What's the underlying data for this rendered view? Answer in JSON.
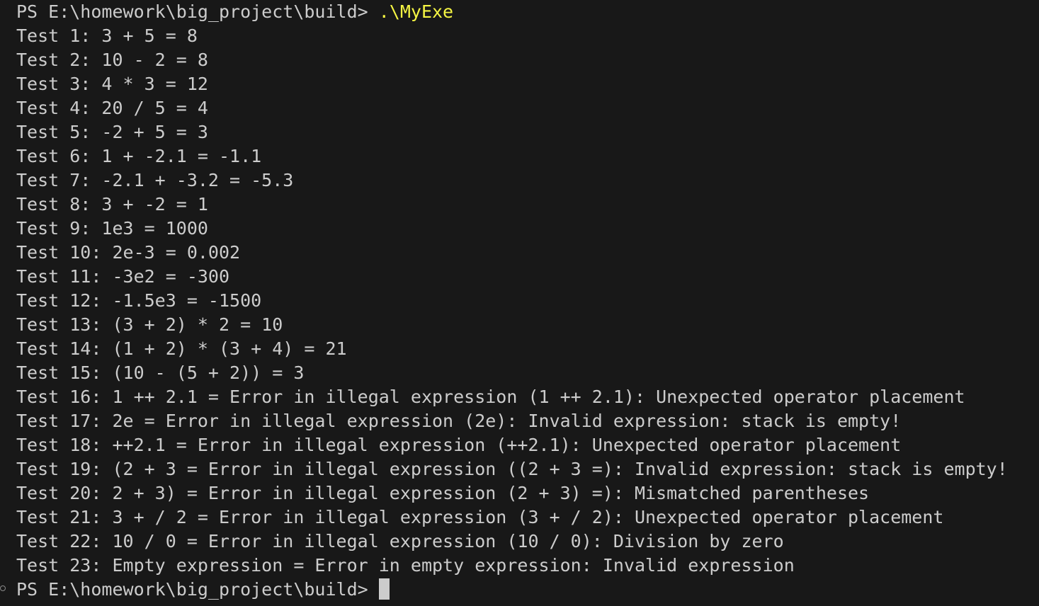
{
  "terminal": {
    "prompt_top": "PS E:\\homework\\big_project\\build> ",
    "command": ".\\MyExe",
    "output_lines": [
      "Test 1: 3 + 5 = 8",
      "Test 2: 10 - 2 = 8",
      "Test 3: 4 * 3 = 12",
      "Test 4: 20 / 5 = 4",
      "Test 5: -2 + 5 = 3",
      "Test 6: 1 + -2.1 = -1.1",
      "Test 7: -2.1 + -3.2 = -5.3",
      "Test 8: 3 + -2 = 1",
      "Test 9: 1e3 = 1000",
      "Test 10: 2e-3 = 0.002",
      "Test 11: -3e2 = -300",
      "Test 12: -1.5e3 = -1500",
      "Test 13: (3 + 2) * 2 = 10",
      "Test 14: (1 + 2) * (3 + 4) = 21",
      "Test 15: (10 - (5 + 2)) = 3",
      "Test 16: 1 ++ 2.1 = Error in illegal expression (1 ++ 2.1): Unexpected operator placement",
      "Test 17: 2e = Error in illegal expression (2e): Invalid expression: stack is empty!",
      "Test 18: ++2.1 = Error in illegal expression (++2.1): Unexpected operator placement",
      "Test 19: (2 + 3 = Error in illegal expression ((2 + 3 =): Invalid expression: stack is empty!",
      "Test 20: 2 + 3) = Error in illegal expression (2 + 3) =): Mismatched parentheses",
      "Test 21: 3 + / 2 = Error in illegal expression (3 + / 2): Unexpected operator placement",
      "Test 22: 10 / 0 = Error in illegal expression (10 / 0): Division by zero",
      "Test 23: Empty expression = Error in empty expression: Invalid expression"
    ],
    "prompt_bottom": "PS E:\\homework\\big_project\\build>"
  },
  "colors": {
    "background": "#181818",
    "text": "#cccccc",
    "command": "#f5f543"
  }
}
